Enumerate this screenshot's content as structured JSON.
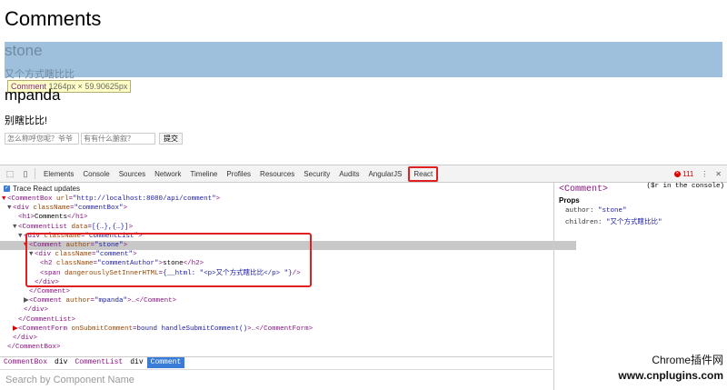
{
  "page": {
    "title": "Comments",
    "comments": [
      {
        "author": "stone",
        "text": "又个方式瞎比比"
      },
      {
        "author": "mpanda",
        "text": "别瞎比比!"
      }
    ],
    "tooltip": {
      "name": "Comment",
      "dims": "1264px × 59.90625px"
    },
    "form": {
      "author_placeholder": "怎么称呼您呢？爷爷",
      "text_placeholder": "有有什么腑叙？",
      "submit_label": "提交"
    }
  },
  "devtools": {
    "tabs": [
      "Elements",
      "Console",
      "Sources",
      "Network",
      "Timeline",
      "Profiles",
      "Resources",
      "Security",
      "Audits",
      "AngularJS",
      "React"
    ],
    "error_count": "111",
    "trace_label": "Trace React updates",
    "tree": [
      {
        "indent": 0,
        "tri": "▼",
        "triRed": true,
        "parts": [
          [
            "tag",
            "<CommentBox "
          ],
          [
            "attr",
            "url"
          ],
          [
            "tag",
            "="
          ],
          [
            "val",
            "\"http://localhost:8080/api/comment\""
          ],
          [
            "tag",
            ">"
          ]
        ]
      },
      {
        "indent": 1,
        "tri": "▼",
        "parts": [
          [
            "tag",
            "<div "
          ],
          [
            "attr",
            "className"
          ],
          [
            "tag",
            "="
          ],
          [
            "val",
            "\"commentBox\""
          ],
          [
            "tag",
            ">"
          ]
        ]
      },
      {
        "indent": 2,
        "tri": "",
        "parts": [
          [
            "tag",
            "<h1>"
          ],
          [
            "txt",
            "Comments"
          ],
          [
            "tag",
            "</h1>"
          ]
        ]
      },
      {
        "indent": 2,
        "tri": "▼",
        "parts": [
          [
            "tag",
            "<CommentList "
          ],
          [
            "attr",
            "data"
          ],
          [
            "tag",
            "="
          ],
          [
            "val",
            "[{…},{…}]"
          ],
          [
            "tag",
            ">"
          ]
        ]
      },
      {
        "indent": 3,
        "tri": "▼",
        "parts": [
          [
            "tag",
            "<div "
          ],
          [
            "attr",
            "className"
          ],
          [
            "tag",
            "="
          ],
          [
            "val",
            "\"commentList\""
          ],
          [
            "tag",
            ">"
          ]
        ]
      },
      {
        "indent": 4,
        "tri": "▼",
        "triRed": true,
        "sel": true,
        "parts": [
          [
            "tag",
            "<Comment "
          ],
          [
            "attr",
            "author"
          ],
          [
            "tag",
            "="
          ],
          [
            "val",
            "\"stone\""
          ],
          [
            "tag",
            ">"
          ]
        ]
      },
      {
        "indent": 5,
        "tri": "▼",
        "parts": [
          [
            "tag",
            "<div "
          ],
          [
            "attr",
            "className"
          ],
          [
            "tag",
            "="
          ],
          [
            "val",
            "\"comment\""
          ],
          [
            "tag",
            ">"
          ]
        ]
      },
      {
        "indent": 6,
        "tri": "",
        "parts": [
          [
            "tag",
            "<h2 "
          ],
          [
            "attr",
            "className"
          ],
          [
            "tag",
            "="
          ],
          [
            "val",
            "\"commentAuthor\""
          ],
          [
            "tag",
            ">"
          ],
          [
            "txt",
            "stone"
          ],
          [
            "tag",
            "</h2>"
          ]
        ]
      },
      {
        "indent": 6,
        "tri": "",
        "parts": [
          [
            "tag",
            "<span "
          ],
          [
            "attr",
            "dangerouslySetInnerHTML"
          ],
          [
            "tag",
            "="
          ],
          [
            "val",
            "{__html: \"<p>又个方式瞎比比</p> \"}"
          ],
          [
            "tag",
            "/>"
          ]
        ]
      },
      {
        "indent": 5,
        "tri": "",
        "parts": [
          [
            "tag",
            "</div>"
          ]
        ]
      },
      {
        "indent": 4,
        "tri": "",
        "parts": [
          [
            "tag",
            "</Comment>"
          ]
        ]
      },
      {
        "indent": 4,
        "tri": "▶",
        "parts": [
          [
            "tag",
            "<Comment "
          ],
          [
            "attr",
            "author"
          ],
          [
            "tag",
            "="
          ],
          [
            "val",
            "\"mpanda\""
          ],
          [
            "tag",
            ">…</Comment>"
          ]
        ]
      },
      {
        "indent": 3,
        "tri": "",
        "parts": [
          [
            "tag",
            "</div>"
          ]
        ]
      },
      {
        "indent": 2,
        "tri": "",
        "parts": [
          [
            "tag",
            "</CommentList>"
          ]
        ]
      },
      {
        "indent": 2,
        "tri": "▶",
        "triRed": true,
        "parts": [
          [
            "tag",
            "<CommentForm "
          ],
          [
            "attr",
            "onSubmitComment"
          ],
          [
            "tag",
            "="
          ],
          [
            "val",
            "bound handleSubmitComment()"
          ],
          [
            "tag",
            ">…</CommentForm>"
          ]
        ]
      },
      {
        "indent": 1,
        "tri": "",
        "parts": [
          [
            "tag",
            "</div>"
          ]
        ]
      },
      {
        "indent": 0,
        "tri": "",
        "parts": [
          [
            "tag",
            "</CommentBox>"
          ]
        ]
      }
    ],
    "side": {
      "title": "<Comment>",
      "hint": "($r in the console)",
      "props_label": "Props",
      "props": [
        {
          "key": "author:",
          "value": "\"stone\""
        },
        {
          "key": "children:",
          "value": "\"又个方式瞎比比\""
        }
      ]
    },
    "breadcrumbs": [
      {
        "label": "CommentBox",
        "comp": true
      },
      {
        "label": "div",
        "comp": false
      },
      {
        "label": "CommentList",
        "comp": true
      },
      {
        "label": "div",
        "comp": false
      },
      {
        "label": "Comment",
        "comp": true,
        "active": true
      }
    ],
    "search_placeholder": "Search by Component Name"
  },
  "watermark": {
    "line1": "Chrome插件网",
    "line2": "www.cnplugins.com"
  },
  "colors": {
    "highlight": "#9fc0dd",
    "accent": "#e02020",
    "selected": "#3a7dd8"
  }
}
